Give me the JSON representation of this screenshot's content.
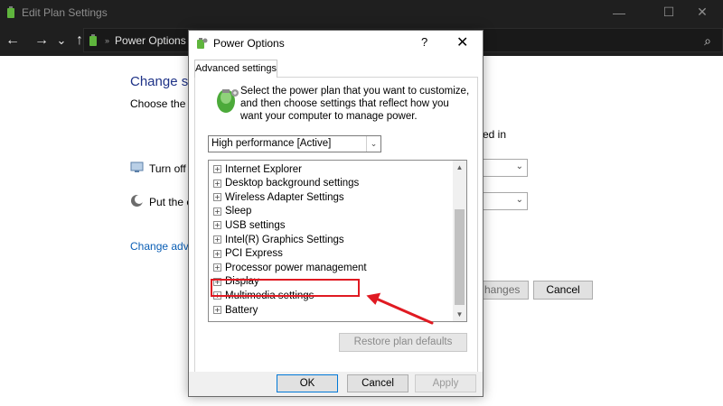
{
  "window": {
    "title": "Edit Plan Settings",
    "minimize_glyph": "—",
    "maximize_glyph": "☐",
    "close_glyph": "✕"
  },
  "address_bar": {
    "back_glyph": "←",
    "forward_glyph": "→",
    "recent_glyph": "⌄",
    "up_glyph": "↑",
    "breadcrumb_separator": "»",
    "breadcrumb": "Power Options",
    "search_glyph": "⌕"
  },
  "background": {
    "heading": "Change se",
    "subtitle": "Choose the sl",
    "column_header": "ed in",
    "row_turn_off": "Turn off t",
    "row_put_the": "Put the co",
    "change_advanced_link": "Change advan",
    "save_changes_button": "hanges",
    "cancel_button": "Cancel",
    "chevron_glyph": "⌄"
  },
  "dialog": {
    "title": "Power Options",
    "help_glyph": "?",
    "close_glyph": "✕",
    "tab_label": "Advanced settings",
    "instructions": "Select the power plan that you want to customize, and then choose settings that reflect how you want your computer to manage power.",
    "plan_select_value": "High performance [Active]",
    "plan_select_chevron": "⌄",
    "tree_expander_glyph": "+",
    "scroll_up_glyph": "▲",
    "scroll_down_glyph": "▼",
    "tree_items": [
      "Internet Explorer",
      "Desktop background settings",
      "Wireless Adapter Settings",
      "Sleep",
      "USB settings",
      "Intel(R) Graphics Settings",
      "PCI Express",
      "Processor power management",
      "Display",
      "Multimedia settings",
      "Battery"
    ],
    "restore_button": "Restore plan defaults",
    "ok_button": "OK",
    "cancel_button": "Cancel",
    "apply_button": "Apply"
  },
  "colors": {
    "highlight": "#e01a22",
    "titlebar_bg": "#1f1f1f",
    "link": "#0a5eb5"
  }
}
